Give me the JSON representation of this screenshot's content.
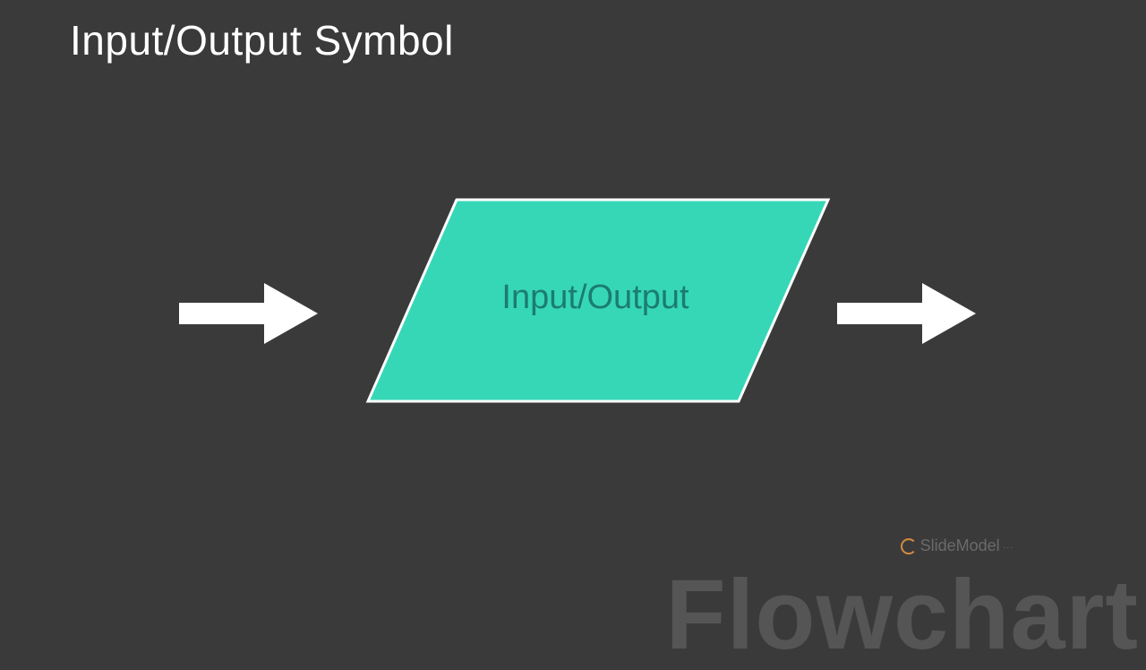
{
  "slide": {
    "title": "Input/Output Symbol",
    "shape_label": "Input/Output",
    "colors": {
      "background": "#3a3a3a",
      "shape_fill": "#36d7b7",
      "shape_stroke": "#ffffff",
      "arrow_fill": "#ffffff",
      "label_text": "#1b7d6f"
    }
  },
  "watermark": {
    "brand": "SlideModel",
    "footer_word": "Flowchart"
  }
}
